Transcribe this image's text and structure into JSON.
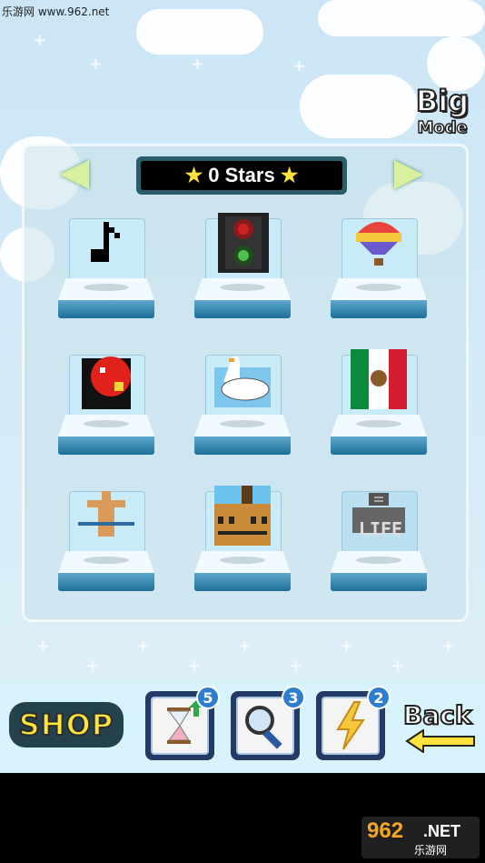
{
  "watermark": "乐游网 www.962.net",
  "mode": {
    "line1": "Big",
    "line2": "Mode"
  },
  "header": {
    "star_left": "★",
    "stars_text": "0 Stars",
    "star_right": "★"
  },
  "puzzles": [
    {
      "icon": "music-note-icon"
    },
    {
      "icon": "traffic-light-icon"
    },
    {
      "icon": "hot-air-balloon-icon"
    },
    {
      "icon": "screaming-face-icon"
    },
    {
      "icon": "swan-icon"
    },
    {
      "icon": "mexico-flag-icon"
    },
    {
      "icon": "bodybuilder-icon"
    },
    {
      "icon": "church-building-icon"
    },
    {
      "icon": "gravestone-icon",
      "label": "LIFE"
    }
  ],
  "bottom": {
    "shop_label": "SHOP",
    "powerups": [
      {
        "icon": "hourglass-icon",
        "count": "5"
      },
      {
        "icon": "magnifier-icon",
        "count": "3"
      },
      {
        "icon": "lightning-icon",
        "count": "2"
      }
    ],
    "back_label": "Back"
  },
  "logo": {
    "num": "962",
    "net": ".NET",
    "cn": "乐游网"
  },
  "colors": {
    "accent_yellow": "#ffe23b",
    "panel_bg": "#c9eaf7",
    "dark_blue": "#233a66"
  }
}
